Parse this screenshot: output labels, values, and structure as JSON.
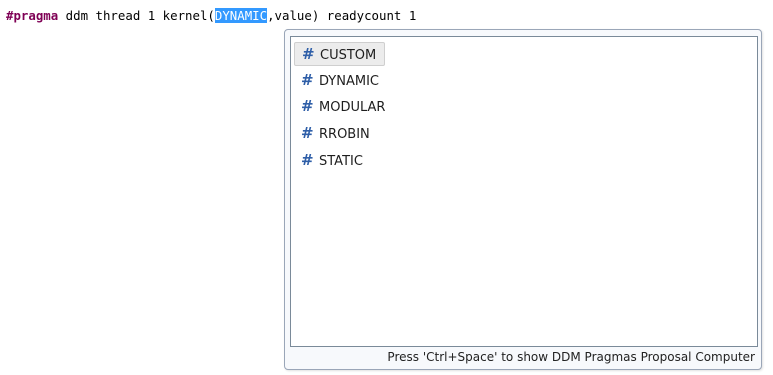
{
  "editor": {
    "code_keyword": "#pragma",
    "code_before_selection": " ddm thread 1 kernel(",
    "code_selected": "DYNAMIC",
    "code_after_selection": ",value) readycount 1"
  },
  "proposal_popup": {
    "items": [
      {
        "icon": "hash-icon",
        "glyph": "#",
        "label": "CUSTOM"
      },
      {
        "icon": "hash-icon",
        "glyph": "#",
        "label": "DYNAMIC"
      },
      {
        "icon": "hash-icon",
        "glyph": "#",
        "label": "MODULAR"
      },
      {
        "icon": "hash-icon",
        "glyph": "#",
        "label": "RROBIN"
      },
      {
        "icon": "hash-icon",
        "glyph": "#",
        "label": "STATIC"
      }
    ],
    "selected_item": "CUSTOM",
    "status_text": "Press 'Ctrl+Space' to show DDM Pragmas Proposal Computer"
  },
  "colors": {
    "keyword": "#7f0055",
    "selection_background": "#3399ff",
    "icon": "#2f5fa8"
  }
}
